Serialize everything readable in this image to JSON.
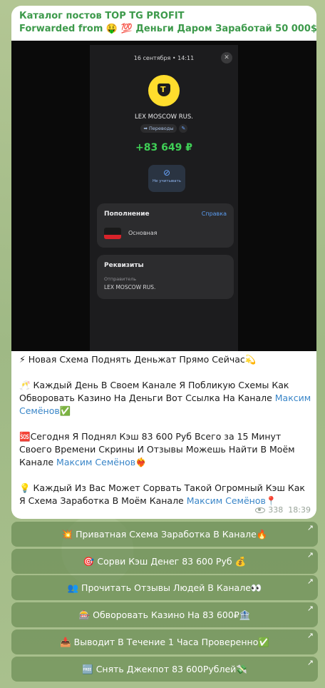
{
  "post": {
    "channel": "Каталог постов TOP TG PROFIT",
    "forwarded_label": "Forwarded from",
    "forwarded_source": "🤑 💯 Деньги Даром Заработай 50 000$💸"
  },
  "screenshot": {
    "date_time": "16 сентября • 14:11",
    "close_glyph": "✕",
    "logo_letter": "T",
    "merchant": "LEX MOSCOW RUS.",
    "tag_label": "➡ Переводы",
    "tag_icon": "✎",
    "amount": "+83 649 ₽",
    "ignore_icon": "⊘",
    "ignore_label": "Не учитывать",
    "topup_title": "Пополнение",
    "help_link": "Справка",
    "account": "Основная",
    "details_title": "Реквизиты",
    "sender_label": "Отправитель",
    "sender_value": "LEX MOSCOW RUS."
  },
  "message": {
    "p1": "⚡ Новая Схема Поднять Деньжат Прямо Сейчас💫",
    "p2_text": "🥂 Каждый День В Своем Канале Я Поблику­ю Схемы Как Обворовать Казино На Деньги Вот Ссылка На Канале ",
    "p2_link": "Максим Семёнов",
    "p2_tail": "✅",
    "p3_text": "🆘Сегодня Я Поднял Кэш 83 600 Руб Всего за 15 Минут Своего Времени Скрины И Отзывы Можешь Найти В Моём Канале ",
    "p3_link": "Максим Семёнов",
    "p3_tail": "❤️‍🔥",
    "p4_text": "💡 Каждый Из Вас Может Сорвать Такой Огромный Кэш Как Я Схема Заработка В Моём Канале ",
    "p4_link": "Максим Семёнов",
    "p4_tail": "📍",
    "views": "338",
    "time": "18:39"
  },
  "buttons": [
    {
      "label": "💥 Приватная Схема Заработка В Канале🔥"
    },
    {
      "label": "🎯 Сорви Кэш Денег 83 600 Руб 💰"
    },
    {
      "label": "👥 Прочитать Отзывы Людей В Канале👀"
    },
    {
      "label": "🎰 Обворовать Казино На 83 600₽🏦"
    },
    {
      "label": "📥 Выводит В Течение 1 Часа Проверенно✅"
    },
    {
      "label": "🆓 Снять Джекпот 83 600Рублей💸"
    }
  ],
  "button_arrow": "↗",
  "colors": {
    "accent_green": "#3d9a4b",
    "link_blue": "#3a86c8",
    "amount_green": "#3fcf56"
  }
}
